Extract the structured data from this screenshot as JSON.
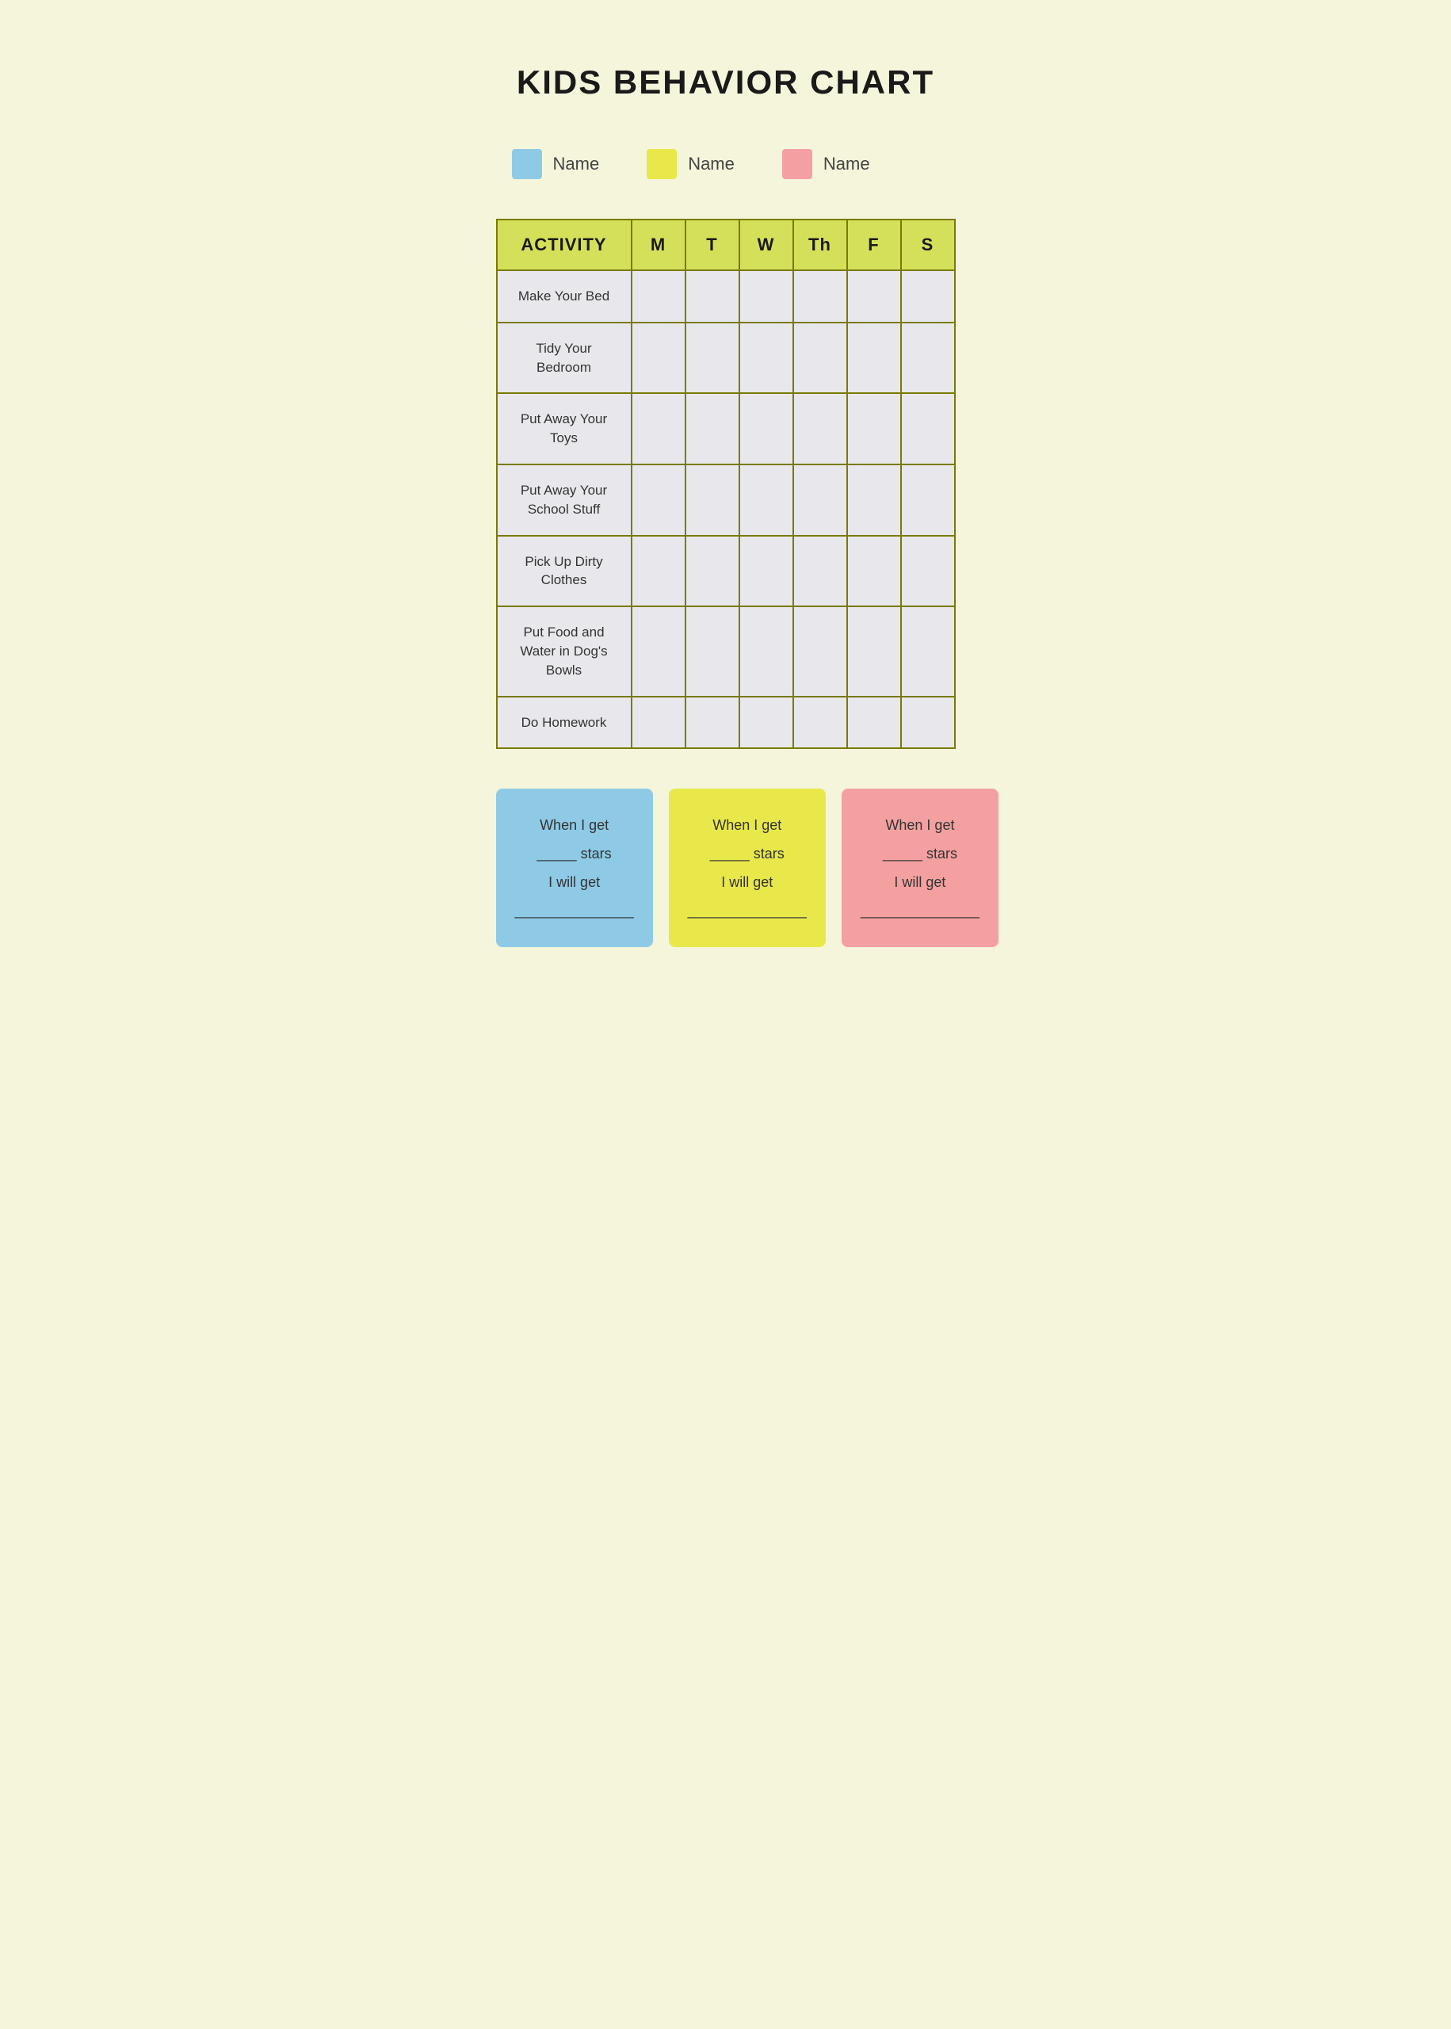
{
  "title": "KIDS BEHAVIOR CHART",
  "legend": {
    "items": [
      {
        "id": "blue",
        "color": "#8ecae6",
        "label": "Name"
      },
      {
        "id": "yellow",
        "color": "#e9e84a",
        "label": "Name"
      },
      {
        "id": "pink",
        "color": "#f4a0a0",
        "label": "Name"
      }
    ]
  },
  "table": {
    "headers": [
      "ACTIVITY",
      "M",
      "T",
      "W",
      "Th",
      "F",
      "S"
    ],
    "rows": [
      "Make Your Bed",
      "Tidy Your Bedroom",
      "Put Away Your Toys",
      "Put Away Your School Stuff",
      "Pick Up Dirty Clothes",
      "Put Food and Water in Dog's Bowls",
      "Do Homework"
    ]
  },
  "rewards": [
    {
      "color": "#8ecae6",
      "line1": "When I get",
      "line2": "_____ stars",
      "line3": "I will get",
      "line4": "_______________"
    },
    {
      "color": "#e9e84a",
      "line1": "When I get",
      "line2": "_____ stars",
      "line3": "I will get",
      "line4": "_______________"
    },
    {
      "color": "#f4a0a0",
      "line1": "When I get",
      "line2": "_____ stars",
      "line3": "I will get",
      "line4": "_______________"
    }
  ]
}
